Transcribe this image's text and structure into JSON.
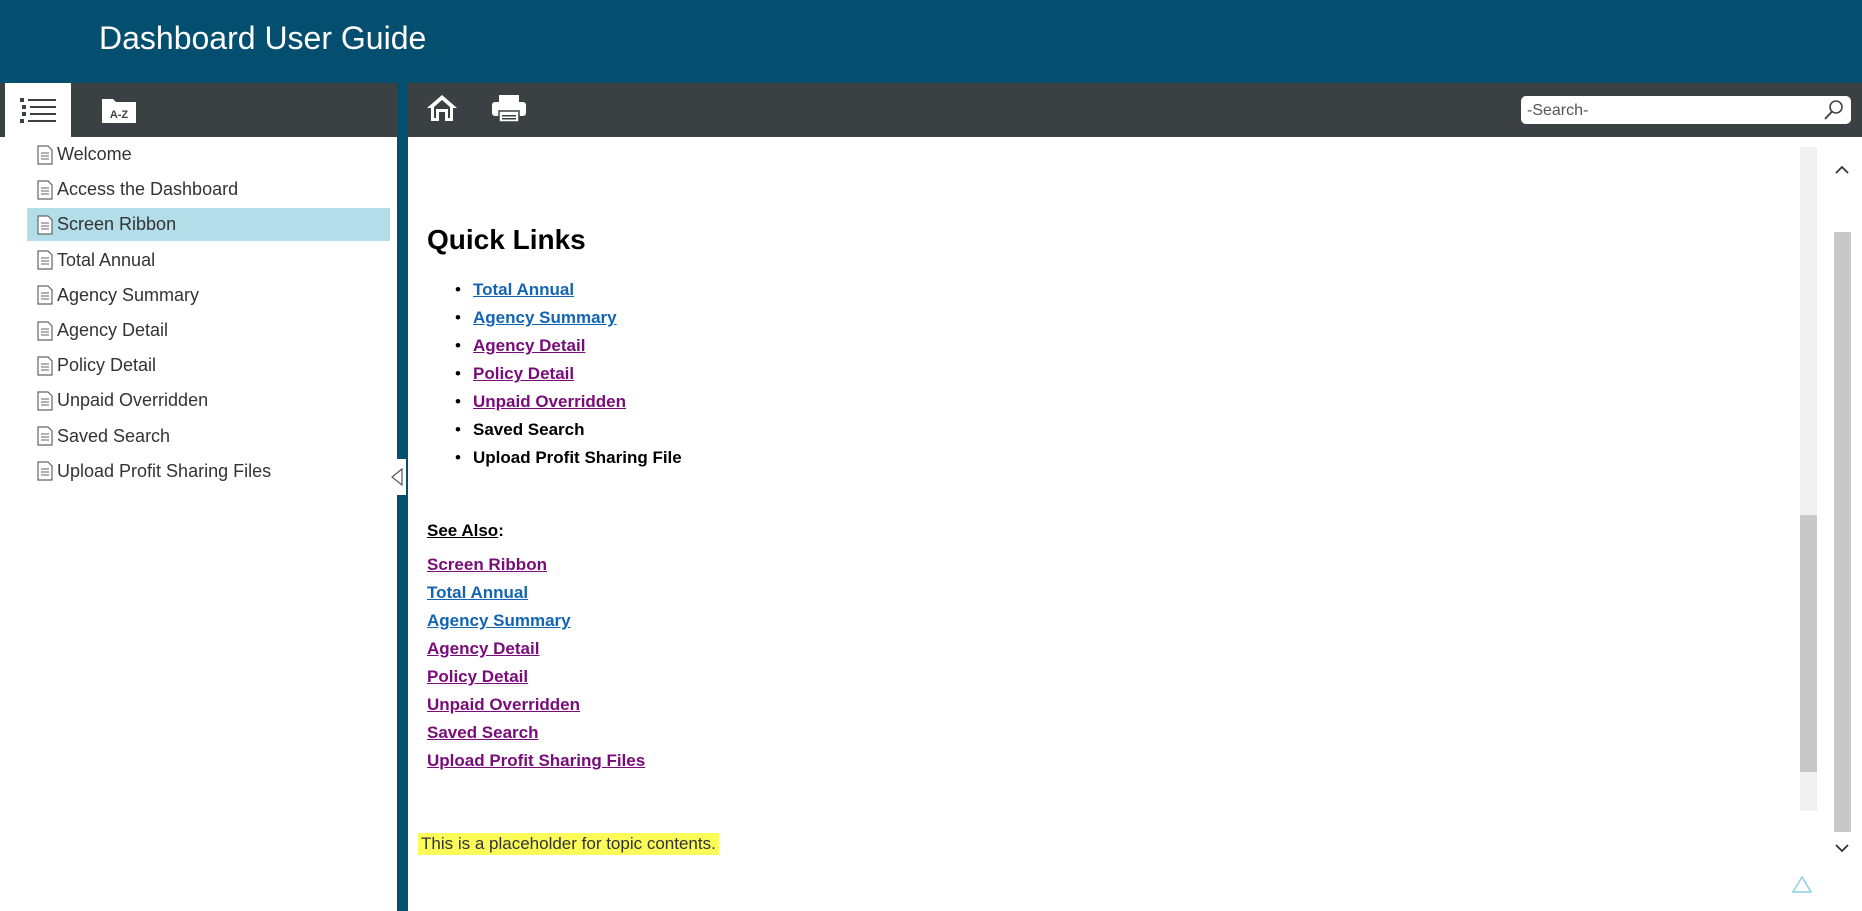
{
  "header": {
    "title": "Dashboard User Guide"
  },
  "left_tabs": {
    "toc_tab_icon": "list-icon",
    "index_tab_label": "A-Z"
  },
  "toolbar": {
    "home_icon": "home-icon",
    "print_icon": "print-icon"
  },
  "search": {
    "placeholder": "-Search-"
  },
  "toc": {
    "items": [
      {
        "label": "Welcome"
      },
      {
        "label": "Access the Dashboard"
      },
      {
        "label": "Screen Ribbon"
      },
      {
        "label": "Total Annual"
      },
      {
        "label": "Agency Summary"
      },
      {
        "label": "Agency Detail"
      },
      {
        "label": "Policy Detail"
      },
      {
        "label": "Unpaid Overridden"
      },
      {
        "label": "Saved Search"
      },
      {
        "label": "Upload Profit Sharing Files"
      }
    ],
    "selected_index": 2
  },
  "content": {
    "quick_links_heading": "Quick Links",
    "quick_links": [
      {
        "label": "Total Annual",
        "style": "blue"
      },
      {
        "label": "Agency Summary",
        "style": "blue"
      },
      {
        "label": "Agency Detail",
        "style": "purple"
      },
      {
        "label": "Policy Detail",
        "style": "purple"
      },
      {
        "label": "Unpaid Overridden",
        "style": "purple"
      },
      {
        "label": "Saved Search",
        "style": "plain"
      },
      {
        "label": "Upload Profit Sharing File",
        "style": "plain"
      }
    ],
    "see_also_label": "See Also",
    "see_also_colon": ":",
    "see_also": [
      {
        "label": "Screen Ribbon",
        "style": "purple"
      },
      {
        "label": "Total Annual",
        "style": "blue"
      },
      {
        "label": "Agency Summary",
        "style": "blue"
      },
      {
        "label": "Agency Detail",
        "style": "purple"
      },
      {
        "label": "Policy Detail",
        "style": "purple"
      },
      {
        "label": "Unpaid Overridden",
        "style": "purple"
      },
      {
        "label": "Saved Search",
        "style": "purple"
      },
      {
        "label": "Upload Profit Sharing Files",
        "style": "purple"
      }
    ],
    "placeholder_text": "This is a placeholder for topic contents."
  },
  "colors": {
    "header_bg": "#044f6f",
    "toolbar_bg": "#3b4042",
    "selected_bg": "#b3dde8",
    "link_blue": "#1464b4",
    "link_visited": "#7a0b7a",
    "highlight": "#fbfb5a"
  }
}
